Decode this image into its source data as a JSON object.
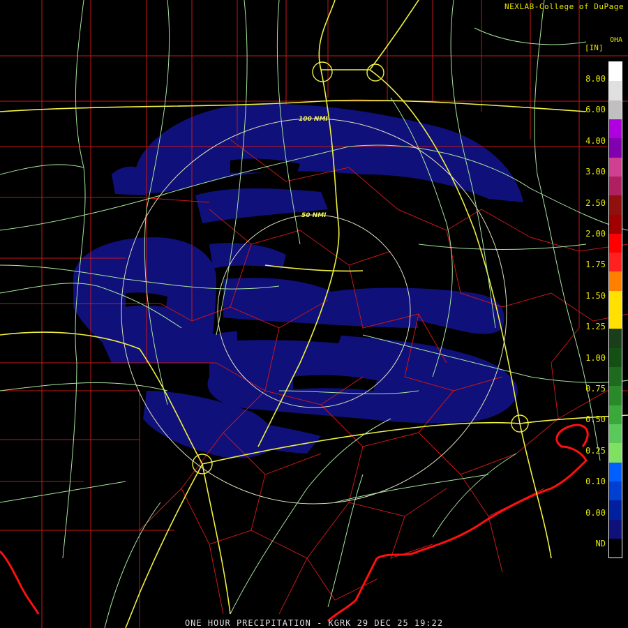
{
  "credit": "NEXLAB-College of DuPage",
  "product_code": "OHA",
  "units": "[IN]",
  "footer": "ONE HOUR PRECIPITATION - KGRK 29 DEC 25 19:22",
  "range_rings": {
    "inner": "50 NMI",
    "outer": "100 NMI"
  },
  "legend": {
    "labels": [
      "8.00",
      "6.00",
      "4.00",
      "3.00",
      "2.50",
      "2.00",
      "1.75",
      "1.50",
      "1.25",
      "1.00",
      "0.75",
      "0.50",
      "0.25",
      "0.10",
      "0.00",
      "ND"
    ],
    "colors": [
      "#ffffff",
      "#e0e0e0",
      "#c0c0c0",
      "#b000e0",
      "#8000b0",
      "#d04090",
      "#b02060",
      "#901010",
      "#a00000",
      "#ff0000",
      "#ff2020",
      "#ff8000",
      "#ffe000",
      "#ffe000",
      "#1a3d1a",
      "#145014",
      "#1e6a1e",
      "#2a8a2a",
      "#3aa83a",
      "#5ac85a",
      "#80e060",
      "#0060ff",
      "#0040d0",
      "#0020a0",
      "#10107a",
      "#000000"
    ]
  }
}
